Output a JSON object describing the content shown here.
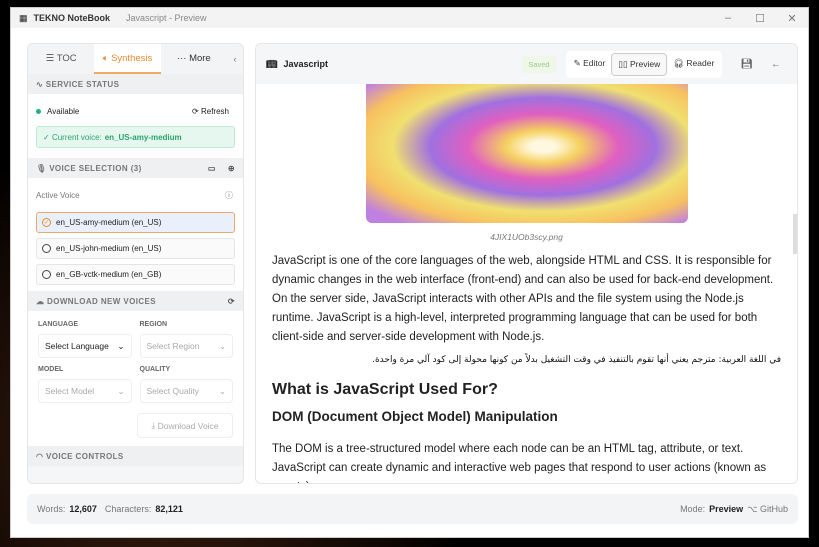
{
  "titlebar": {
    "app": "TEKNO NoteBook",
    "doc": "Javascript - Preview"
  },
  "left": {
    "tabs": [
      "TOC",
      "Synthesis",
      "More"
    ],
    "service_status": "SERVICE STATUS",
    "available": "Available",
    "refresh": "Refresh",
    "current_voice_label": "Current voice:",
    "current_voice": "en_US-amy-medium",
    "voice_selection": "VOICE SELECTION (3)",
    "active_voice": "Active Voice",
    "voices": [
      "en_US-amy-medium (en_US)",
      "en_US-john-medium (en_US)",
      "en_GB-vctk-medium (en_GB)"
    ],
    "download_new": "DOWNLOAD NEW VOICES",
    "language_label": "LANGUAGE",
    "language": "Select Language",
    "region_label": "REGION",
    "region": "Select Region",
    "model_label": "MODEL",
    "model": "Select Model",
    "quality_label": "QUALITY",
    "quality": "Select Quality",
    "download_btn": "Download Voice",
    "voice_controls": "VOICE CONTROLS"
  },
  "right": {
    "title": "Javascript",
    "saved": "Saved",
    "modes": [
      "Editor",
      "Preview",
      "Reader"
    ],
    "caption": "4JIX1UOb3scy.png",
    "p1": "JavaScript is one of the core languages of the web, alongside HTML and CSS. It is responsible for dynamic changes in the web interface (front-end) and can also be used for back-end development. On the server side, JavaScript interacts with other APIs and the file system using the Node.js runtime. JavaScript is a high-level, interpreted programming language that can be used for both client-side and server-side development with Node.js.",
    "arabic": "في اللغة العربية: مترجم يعني أنها تقوم بالتنفيذ في وقت التشغيل بدلاً من كونها محولة إلى كود آلي مرة واحدة.",
    "h1": "What is JavaScript Used For?",
    "h2": "DOM (Document Object Model) Manipulation",
    "p2": "The DOM is a tree-structured model where each node can be an HTML tag, attribute, or text. JavaScript can create dynamic and interactive web pages that respond to user actions (known as events)."
  },
  "footer": {
    "words_label": "Words:",
    "words": "12,607",
    "chars_label": "Characters:",
    "chars": "82,121",
    "mode_label": "Mode:",
    "mode": "Preview",
    "github": "GitHub"
  }
}
